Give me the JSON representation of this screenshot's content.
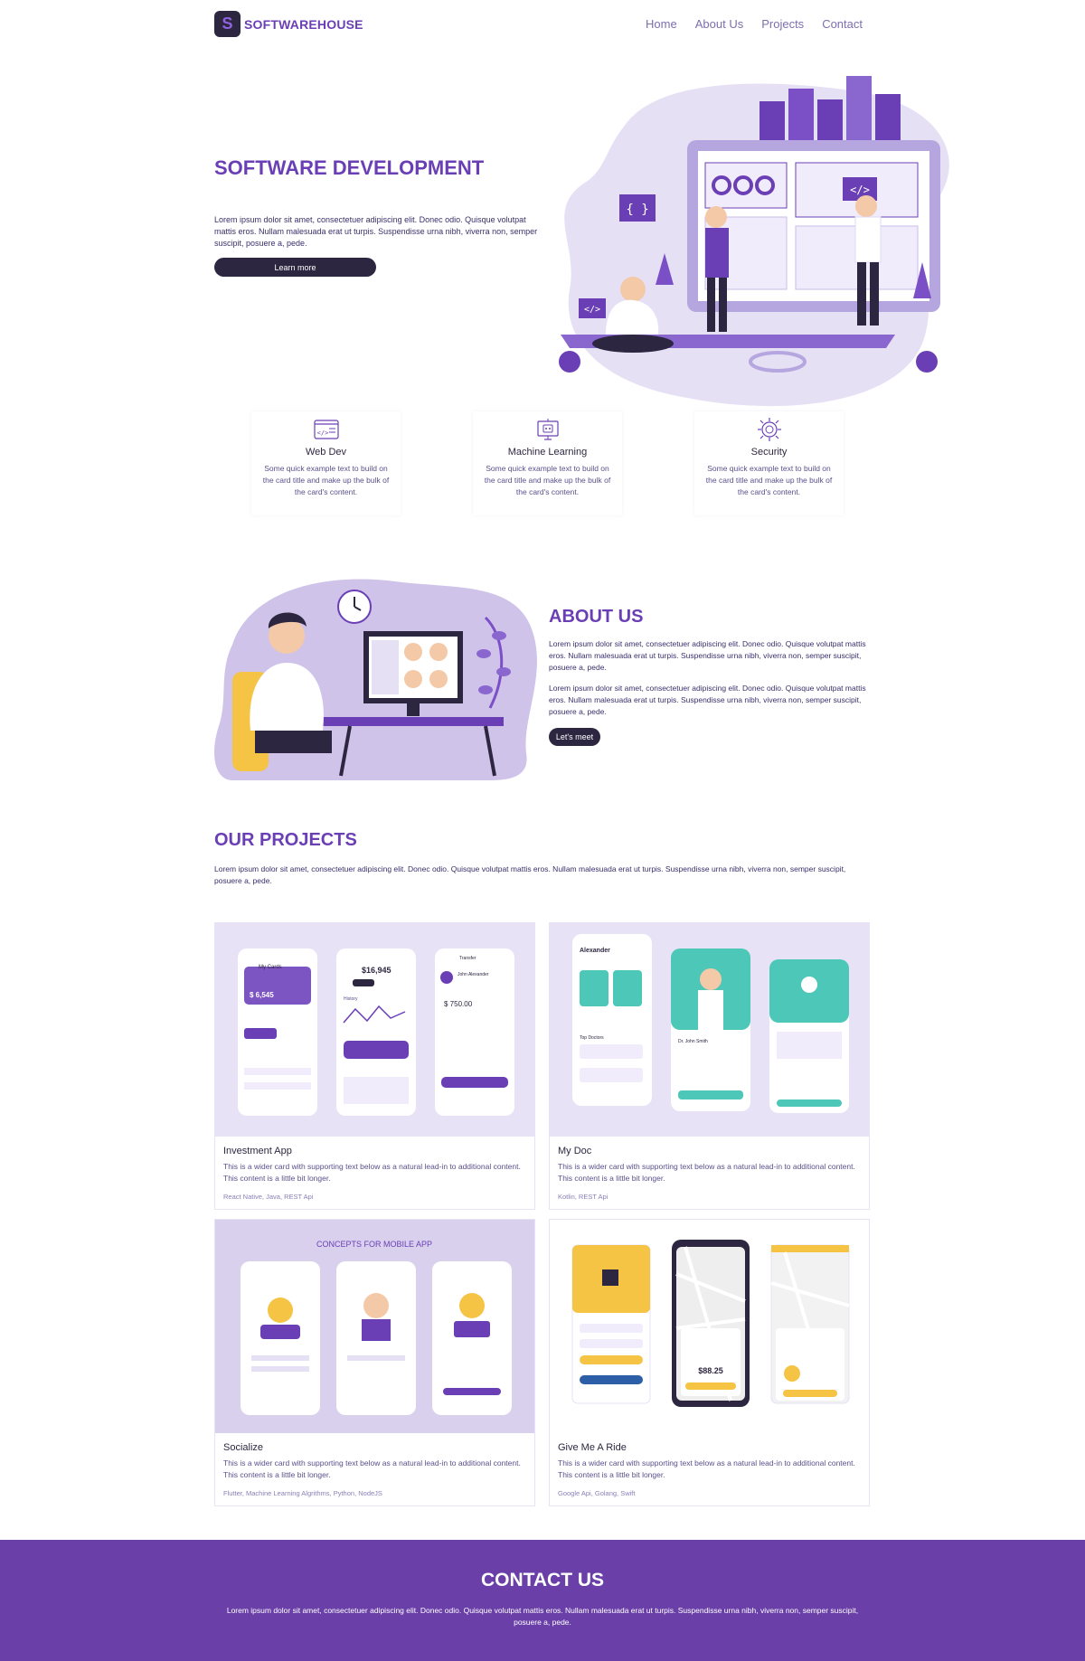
{
  "nav": {
    "brand_logo": "S",
    "brand_name": "SOFTWAREHOUSE",
    "links": [
      "Home",
      "About Us",
      "Projects",
      "Contact"
    ]
  },
  "hero": {
    "title": "SOFTWARE DEVELOPMENT",
    "text": "Lorem ipsum dolor sit amet, consectetuer adipiscing elit. Donec odio. Quisque volutpat mattis eros. Nullam malesuada erat ut turpis. Suspendisse urna nibh, viverra non, semper suscipit, posuere a, pede.",
    "button": "Learn more",
    "illustration_icon": "developer-team-illustration"
  },
  "features": [
    {
      "icon": "code-window-icon",
      "title": "Web Dev",
      "text": "Some quick example text to build on the card title and make up the bulk of the card's content."
    },
    {
      "icon": "robot-monitor-icon",
      "title": "Machine Learning",
      "text": "Some quick example text to build on the card title and make up the bulk of the card's content."
    },
    {
      "icon": "security-gear-icon",
      "title": "Security",
      "text": "Some quick example text to build on the card title and make up the bulk of the card's content."
    }
  ],
  "about": {
    "title": "ABOUT US",
    "p1": "Lorem ipsum dolor sit amet, consectetuer adipiscing elit. Donec odio. Quisque volutpat mattis eros. Nullam malesuada erat ut turpis. Suspendisse urna nibh, viverra non, semper suscipit, posuere a, pede.",
    "p2": "Lorem ipsum dolor sit amet, consectetuer adipiscing elit. Donec odio. Quisque volutpat mattis eros. Nullam malesuada erat ut turpis. Suspendisse urna nibh, viverra non, semper suscipit, posuere a, pede.",
    "button": "Let's meet",
    "illustration_icon": "video-call-illustration"
  },
  "projects": {
    "title": "OUR PROJECTS",
    "text": "Lorem ipsum dolor sit amet, consectetuer adipiscing elit. Donec odio. Quisque volutpat mattis eros. Nullam malesuada erat ut turpis. Suspendisse urna nibh, viverra non, semper suscipit, posuere a, pede.",
    "items": [
      {
        "title": "Investment App",
        "text": "This is a wider card with supporting text below as a natural lead-in to additional content. This content is a little bit longer.",
        "tags": "React Native, Java, REST Api",
        "screen_labels": [
          "My Cards",
          "$ 6,545",
          "$16,945",
          "History",
          "Transfer",
          "John Alexander",
          "$ 750.00"
        ]
      },
      {
        "title": "My Doc",
        "text": "This is a wider card with supporting text below as a natural lead-in to additional content. This content is a little bit longer.",
        "tags": "Kotlin, REST Api",
        "screen_labels": [
          "Alexander",
          "Top Doctors",
          "Dr. John Smith"
        ]
      },
      {
        "title": "Socialize",
        "text": "This is a wider card with supporting text below as a natural lead-in to additional content. This content is a little bit longer.",
        "tags": "Flutter, Machine Learning Algrithms, Python, NodeJS",
        "screen_labels": [
          "CONCEPTS FOR MOBILE APP"
        ]
      },
      {
        "title": "Give Me A Ride",
        "text": "This is a wider card with supporting text below as a natural lead-in to additional content. This content is a little bit longer.",
        "tags": "Google Api, Golang, Swift",
        "screen_labels": [
          "$88.25"
        ]
      }
    ]
  },
  "contact": {
    "title": "CONTACT US",
    "text": "Lorem ipsum dolor sit amet, consectetuer adipiscing elit. Donec odio. Quisque volutpat mattis eros. Nullam malesuada erat ut turpis. Suspendisse urna nibh, viverra non, semper suscipit, posuere a, pede."
  },
  "colors": {
    "accent": "#6a3fb5",
    "dark": "#2d2640",
    "contact_bg": "#6a3fa8",
    "lavender": "#c9bde8",
    "teal": "#4cc7b8",
    "yellow": "#f5c445"
  }
}
